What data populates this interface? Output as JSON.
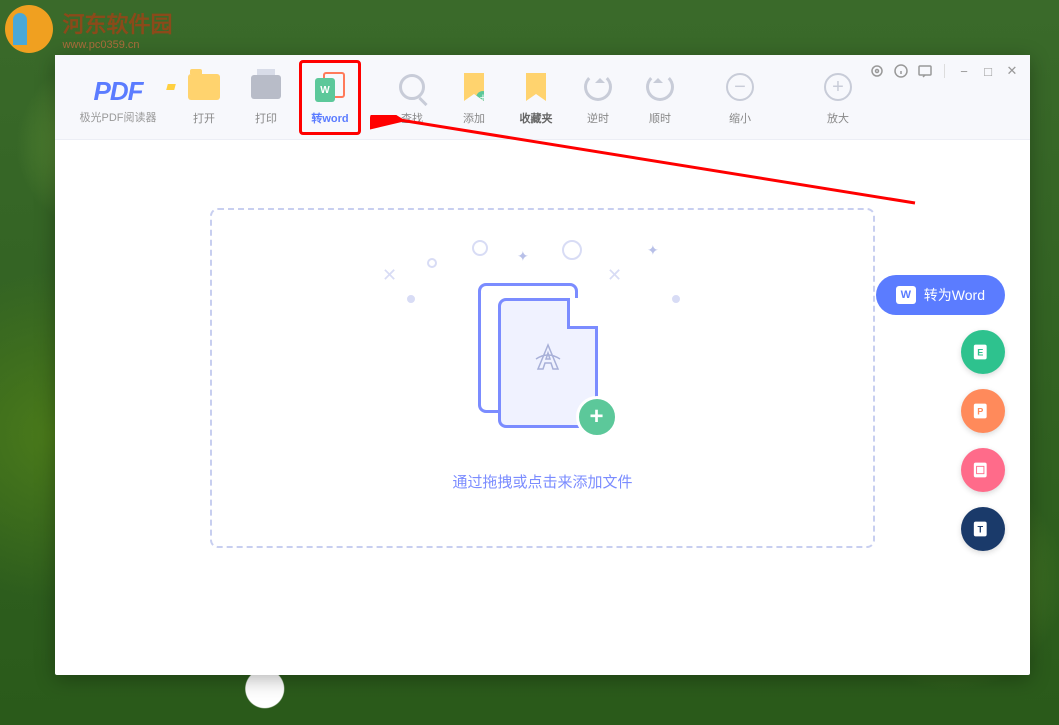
{
  "watermark": {
    "title": "河东软件园",
    "url": "www.pc0359.cn"
  },
  "app": {
    "logo_text": "PDF",
    "logo_subtitle": "极光PDF阅读器"
  },
  "toolbar": {
    "open": "打开",
    "print": "打印",
    "to_word": "转word",
    "search": "查找",
    "add": "添加",
    "favorites": "收藏夹",
    "rotate_ccw": "逆时",
    "rotate_cw": "顺时",
    "zoom_out": "缩小",
    "zoom_in": "放大"
  },
  "dropzone": {
    "hint": "通过拖拽或点击来添加文件"
  },
  "side": {
    "convert_word": "转为Word"
  },
  "icons": {
    "word_badge": "W"
  }
}
